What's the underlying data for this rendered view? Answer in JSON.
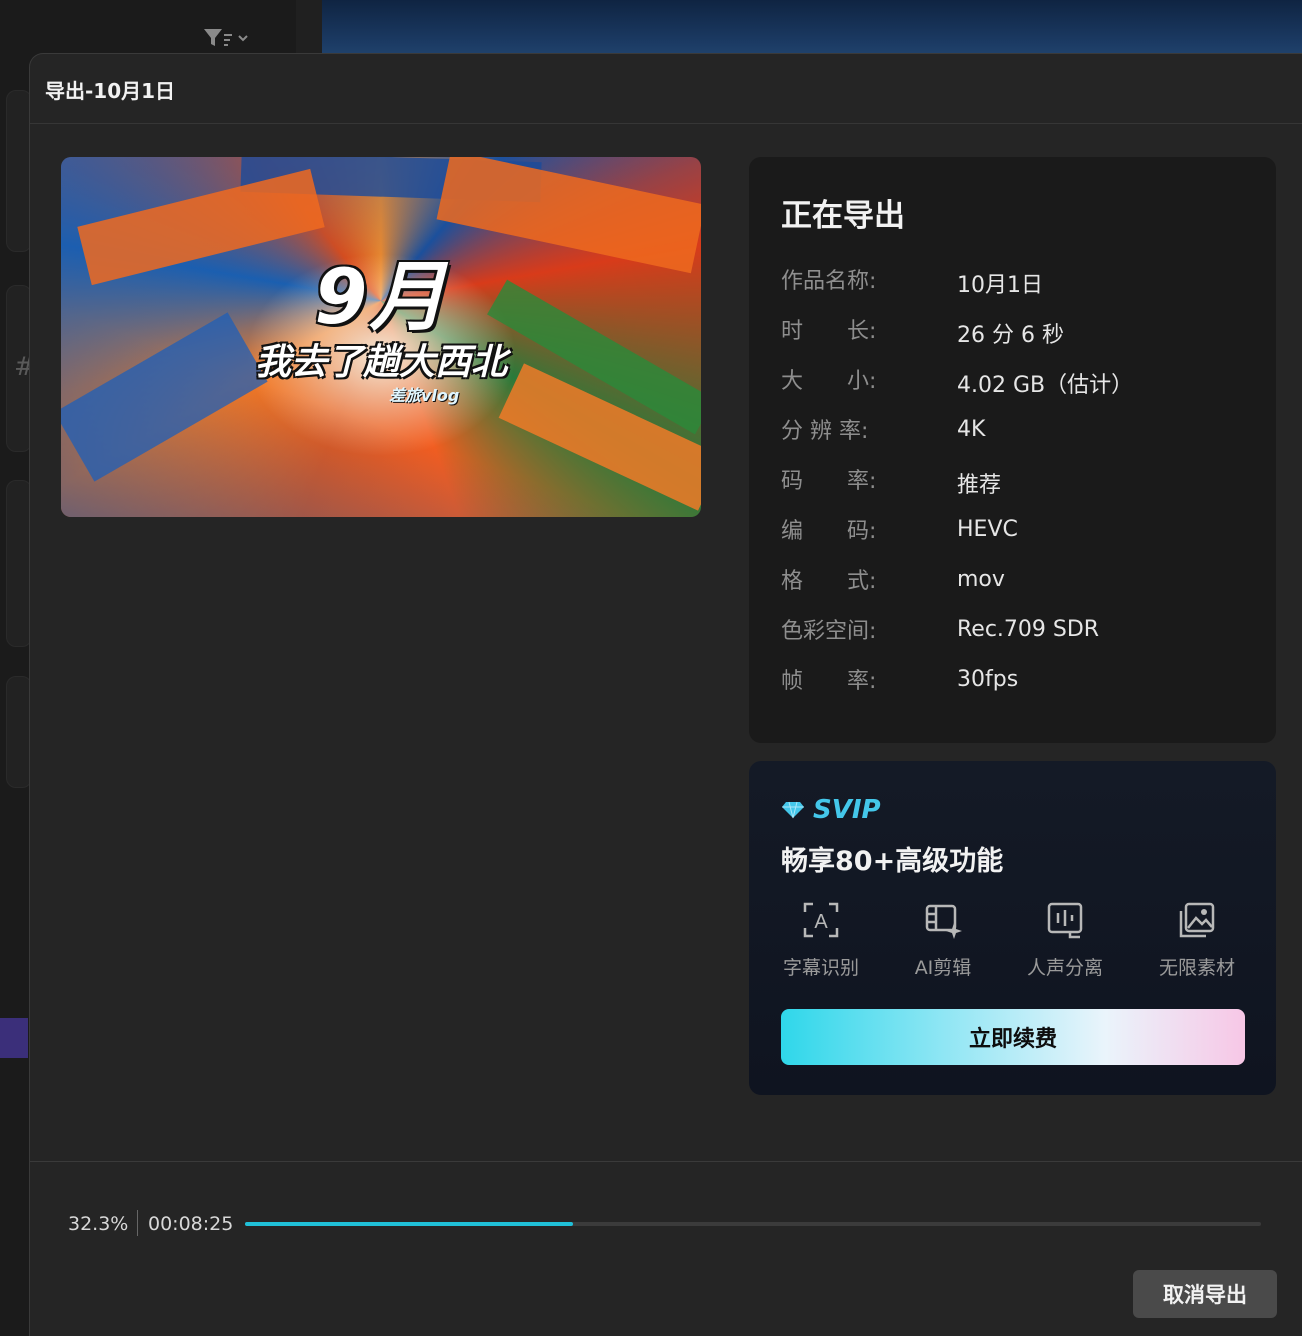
{
  "dialog": {
    "title": "导出-10月1日"
  },
  "thumbnail": {
    "title": "9月",
    "subtitle": "我去了趟大西北",
    "tag": "差旅vlog"
  },
  "info": {
    "heading": "正在导出",
    "rows": [
      {
        "key": "作品名称:",
        "value": "10月1日"
      },
      {
        "key": "时　　长:",
        "value": "26 分 6 秒"
      },
      {
        "key": "大　　小:",
        "value": "4.02 GB（估计）"
      },
      {
        "key": "分 辨 率:",
        "value": "4K"
      },
      {
        "key": "码　　率:",
        "value": "推荐"
      },
      {
        "key": "编　　码:",
        "value": "HEVC"
      },
      {
        "key": "格　　式:",
        "value": "mov"
      },
      {
        "key": "色彩空间:",
        "value": "Rec.709 SDR"
      },
      {
        "key": "帧　　率:",
        "value": "30fps"
      }
    ]
  },
  "svip": {
    "logo": "SVIP",
    "headline": "畅享80+高级功能",
    "features": [
      {
        "label": "字幕识别",
        "icon": "subtitle-recognition-icon"
      },
      {
        "label": "AI剪辑",
        "icon": "ai-edit-icon"
      },
      {
        "label": "人声分离",
        "icon": "voice-separation-icon"
      },
      {
        "label": "无限素材",
        "icon": "unlimited-assets-icon"
      }
    ],
    "renew_label": "立即续费",
    "accent": "#44c7ea"
  },
  "progress": {
    "percent_text": "32.3%",
    "percent": 0.323,
    "elapsed": "00:08:25",
    "bar_color": "#20c0d8"
  },
  "cancel_label": "取消导出"
}
